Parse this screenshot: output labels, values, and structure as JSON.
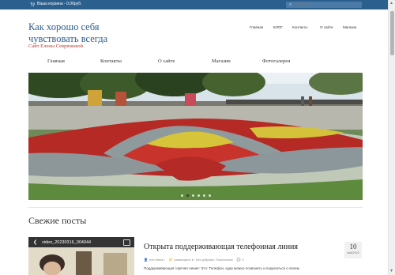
{
  "topbar": {
    "cart_text": "Ваша корзина - 0.00руб.",
    "search_placeholder": "Искать"
  },
  "site": {
    "title": "Как хорошо себя чувствовать всегда",
    "subtitle": "Сайт Елены Севрюковой"
  },
  "top_menu": [
    "Главная",
    "БЛОГ",
    "Контакты",
    "О сайте",
    "Магазин"
  ],
  "main_menu": [
    "Главная",
    "Контакты",
    "О сайте",
    "Магазин",
    "Фотогалерея"
  ],
  "slider": {
    "dots": 6,
    "active_dot": 1
  },
  "section": {
    "title": "Свежие посты"
  },
  "post": {
    "video_title": "video_20230316_004044",
    "title": "Открыта поддерживающая телефонная линия",
    "date_day": "10",
    "date_month": "май/2023",
    "author": "нон elena i",
    "category_prefix": "размещено в:",
    "category": "Без рубрики, Психология",
    "comments": "0",
    "excerpt": "Поддерживающая горячая линия: Это: Телефон, куда можно позвонить и поделиться о своем"
  },
  "colors": {
    "topbar": "#2b5f8e",
    "title": "#2b5f8e",
    "subtitle": "#c0392b"
  }
}
